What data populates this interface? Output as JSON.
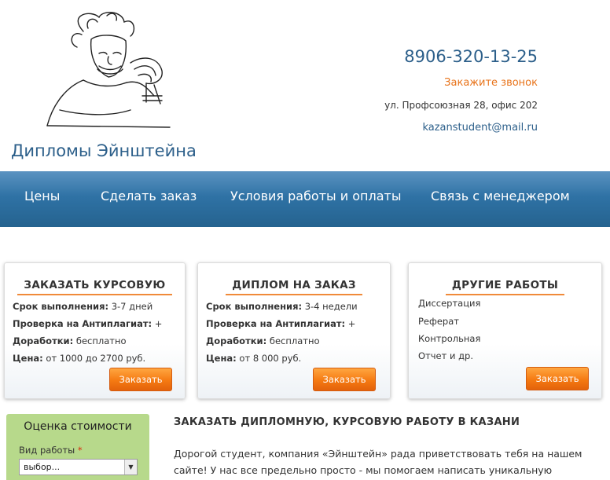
{
  "header": {
    "site_title": "Дипломы Эйнштейна",
    "phone": "8906-320-13-25",
    "callback": "Закажите звонок",
    "address": "ул. Профсоюзная 28, офис 202",
    "email": "kazanstudent@mail.ru"
  },
  "nav": {
    "items": [
      {
        "label": "Цены"
      },
      {
        "label": "Сделать заказ"
      },
      {
        "label": "Условия работы и оплаты"
      },
      {
        "label": "Связь с менеджером"
      }
    ]
  },
  "cards": [
    {
      "title": "ЗАКАЗАТЬ КУРСОВУЮ",
      "lines": [
        {
          "key": "Срок выполнения:",
          "value": " 3-7 дней"
        },
        {
          "key": "Проверка на Антиплагиат:",
          "value": " +"
        },
        {
          "key": "Доработки:",
          "value": " бесплатно"
        },
        {
          "key": "Цена:",
          "value": " от 1000 до 2700 руб."
        }
      ],
      "button": "Заказать"
    },
    {
      "title": "ДИПЛОМ НА ЗАКАЗ",
      "lines": [
        {
          "key": "Срок выполнения:",
          "value": " 3-4 недели"
        },
        {
          "key": "Проверка на Антиплагиат:",
          "value": " +"
        },
        {
          "key": "Доработки:",
          "value": " бесплатно"
        },
        {
          "key": "Цена:",
          "value": " от 8 000 руб."
        }
      ],
      "button": "Заказать"
    },
    {
      "title": "ДРУГИЕ РАБОТЫ",
      "items": [
        "Диссертация",
        "Реферат",
        "Контрольная",
        "Отчет и др."
      ],
      "button": "Заказать"
    }
  ],
  "estimate": {
    "title": "Оценка стоимости",
    "field_label": "Вид работы",
    "required_mark": "*",
    "select_value": "выбор..."
  },
  "article": {
    "title": "ЗАКАЗАТЬ ДИПЛОМНУЮ, КУРСОВУЮ РАБОТУ В КАЗАНИ",
    "text": "Дорогой студент, компания «Эйнштейн» рада приветствовать тебя на нашем сайте! У нас все предельно просто - мы помогаем написать уникальную учебную работу, а не"
  },
  "colors": {
    "brand_blue": "#2c5f8a",
    "accent_orange": "#e8731a",
    "nav_blue": "#2f72a5",
    "estimate_green": "#b7d98b"
  }
}
